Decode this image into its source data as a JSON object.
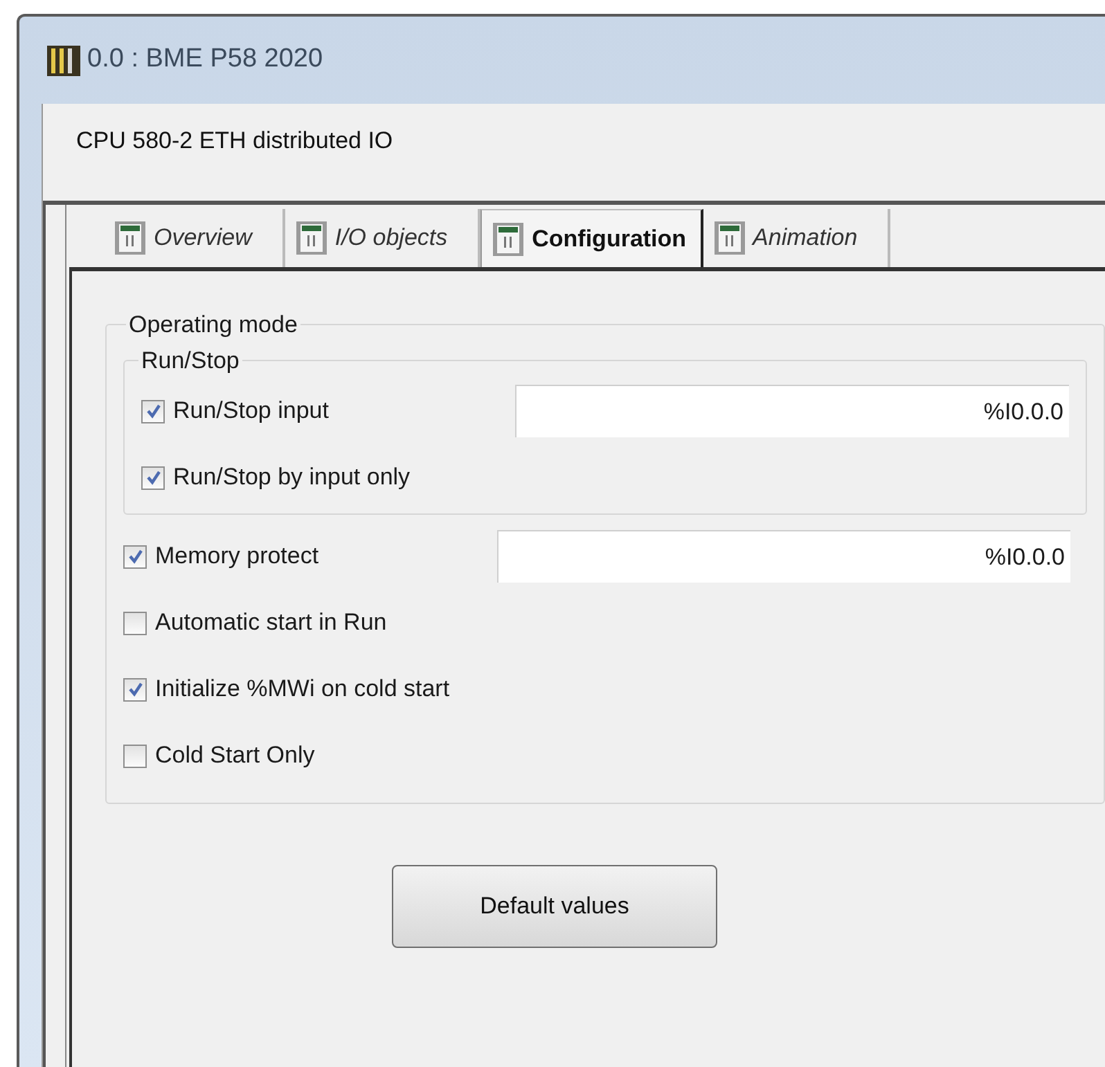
{
  "window": {
    "title": "0.0 : BME P58 2020"
  },
  "subtitle": "CPU 580-2 ETH distributed IO",
  "tabs": [
    {
      "label": "Overview",
      "selected": false
    },
    {
      "label": "I/O objects",
      "selected": false
    },
    {
      "label": "Configuration",
      "selected": true
    },
    {
      "label": "Animation",
      "selected": false
    }
  ],
  "group": {
    "title": "Operating mode",
    "subgroup": {
      "title": "Run/Stop",
      "options": [
        {
          "label": "Run/Stop input",
          "checked": true,
          "value": "%I0.0.0"
        },
        {
          "label": "Run/Stop by input only",
          "checked": true
        }
      ]
    },
    "options": [
      {
        "label": "Memory protect",
        "checked": true,
        "value": "%I0.0.0"
      },
      {
        "label": "Automatic start in Run",
        "checked": false
      },
      {
        "label": "Initialize %MWi on cold start",
        "checked": true
      },
      {
        "label": "Cold Start Only",
        "checked": false
      }
    ]
  },
  "button": "Default values"
}
